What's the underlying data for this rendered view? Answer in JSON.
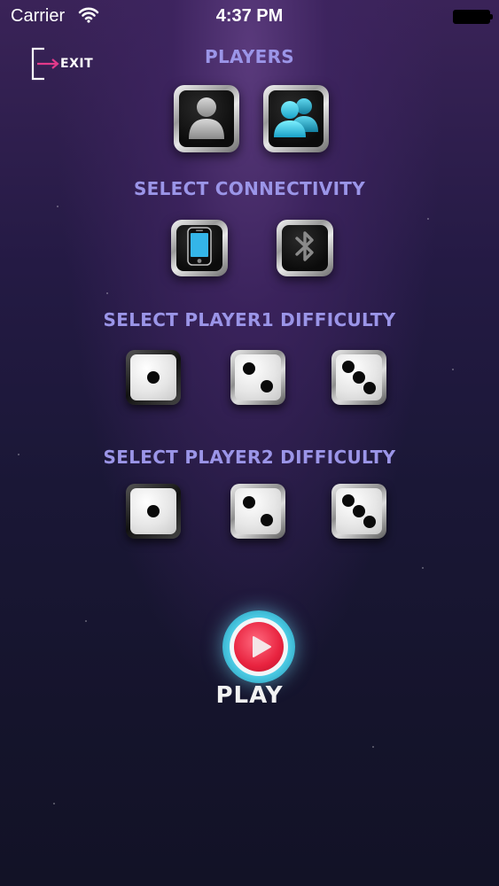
{
  "status_bar": {
    "carrier": "Carrier",
    "time": "4:37 PM"
  },
  "exit": {
    "label": "EXIT"
  },
  "players": {
    "heading": "PLAYERS",
    "options": [
      {
        "icon": "single-player-icon",
        "selected": true
      },
      {
        "icon": "two-players-icon",
        "selected": false
      }
    ]
  },
  "connectivity": {
    "heading": "SELECT CONNECTIVITY",
    "options": [
      {
        "icon": "phone-icon"
      },
      {
        "icon": "bluetooth-icon"
      }
    ]
  },
  "player1_difficulty": {
    "heading": "SELECT PLAYER1 DIFFICULTY",
    "levels": [
      1,
      2,
      3
    ],
    "selected": 1
  },
  "player2_difficulty": {
    "heading": "SELECT PLAYER2 DIFFICULTY",
    "levels": [
      1,
      2,
      3
    ],
    "selected": 1
  },
  "play": {
    "label": "PLAY"
  },
  "colors": {
    "heading": "#9b95e8",
    "play_red": "#e8233f",
    "play_glow": "#4fcfe8",
    "accent_cyan": "#35d0f0"
  }
}
